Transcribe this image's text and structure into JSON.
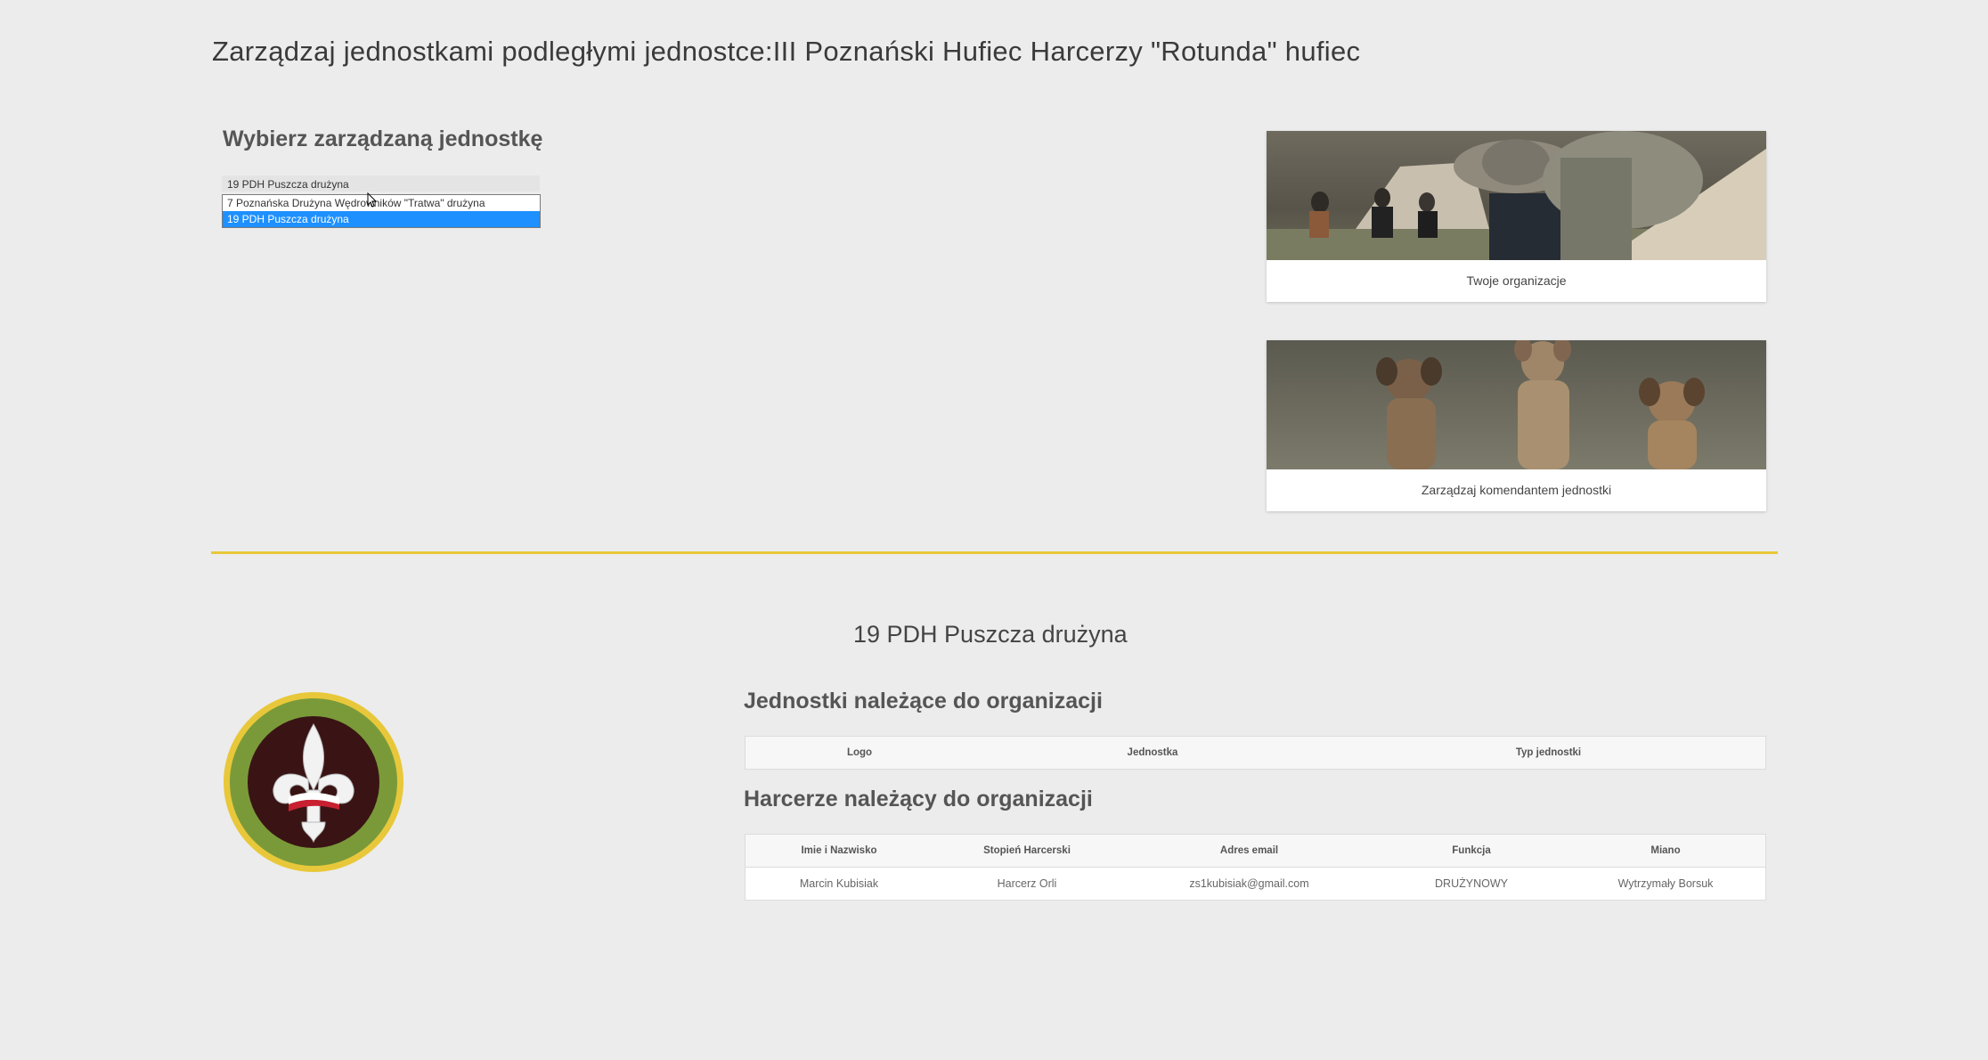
{
  "page": {
    "title": "Zarządzaj jednostkami podległymi jednostce:III Poznański Hufiec Harcerzy \"Rotunda\" hufiec"
  },
  "unit_selector": {
    "heading": "Wybierz zarządzaną jednostkę",
    "selected_value": "19 PDH Puszcza drużyna",
    "options": [
      {
        "label": "7 Poznańska Drużyna Wędrowników \"Tratwa\" drużyna",
        "selected": false
      },
      {
        "label": "19 PDH Puszcza drużyna",
        "selected": true
      }
    ]
  },
  "cards": [
    {
      "label": "Twoje organizacje",
      "image": "scout-with-backpack-photo"
    },
    {
      "label": "Zarządzaj komendantem jednostki",
      "image": "three-puppies-photo"
    }
  ],
  "unit": {
    "name": "19 PDH Puszcza drużyna",
    "emblem": "fleur-de-lis-emblem"
  },
  "units_section": {
    "heading": "Jednostki należące do organizacji",
    "columns": [
      "Logo",
      "Jednostka",
      "Typ jednostki"
    ],
    "rows": []
  },
  "scouts_section": {
    "heading": "Harcerze należący do organizacji",
    "columns": [
      "Imie i Nazwisko",
      "Stopień Harcerski",
      "Adres email",
      "Funkcja",
      "Miano"
    ],
    "rows": [
      [
        "Marcin Kubisiak",
        "Harcerz Orli",
        "zs1kubisiak@gmail.com",
        "DRUŻYNOWY",
        "Wytrzymały Borsuk"
      ]
    ]
  },
  "colors": {
    "background": "#ececec",
    "divider": "#e8c83a",
    "selection": "#1e90ff",
    "emblem_ring": "#e8c83a",
    "emblem_band": "#7a9a3a",
    "emblem_center": "#3a1414"
  }
}
